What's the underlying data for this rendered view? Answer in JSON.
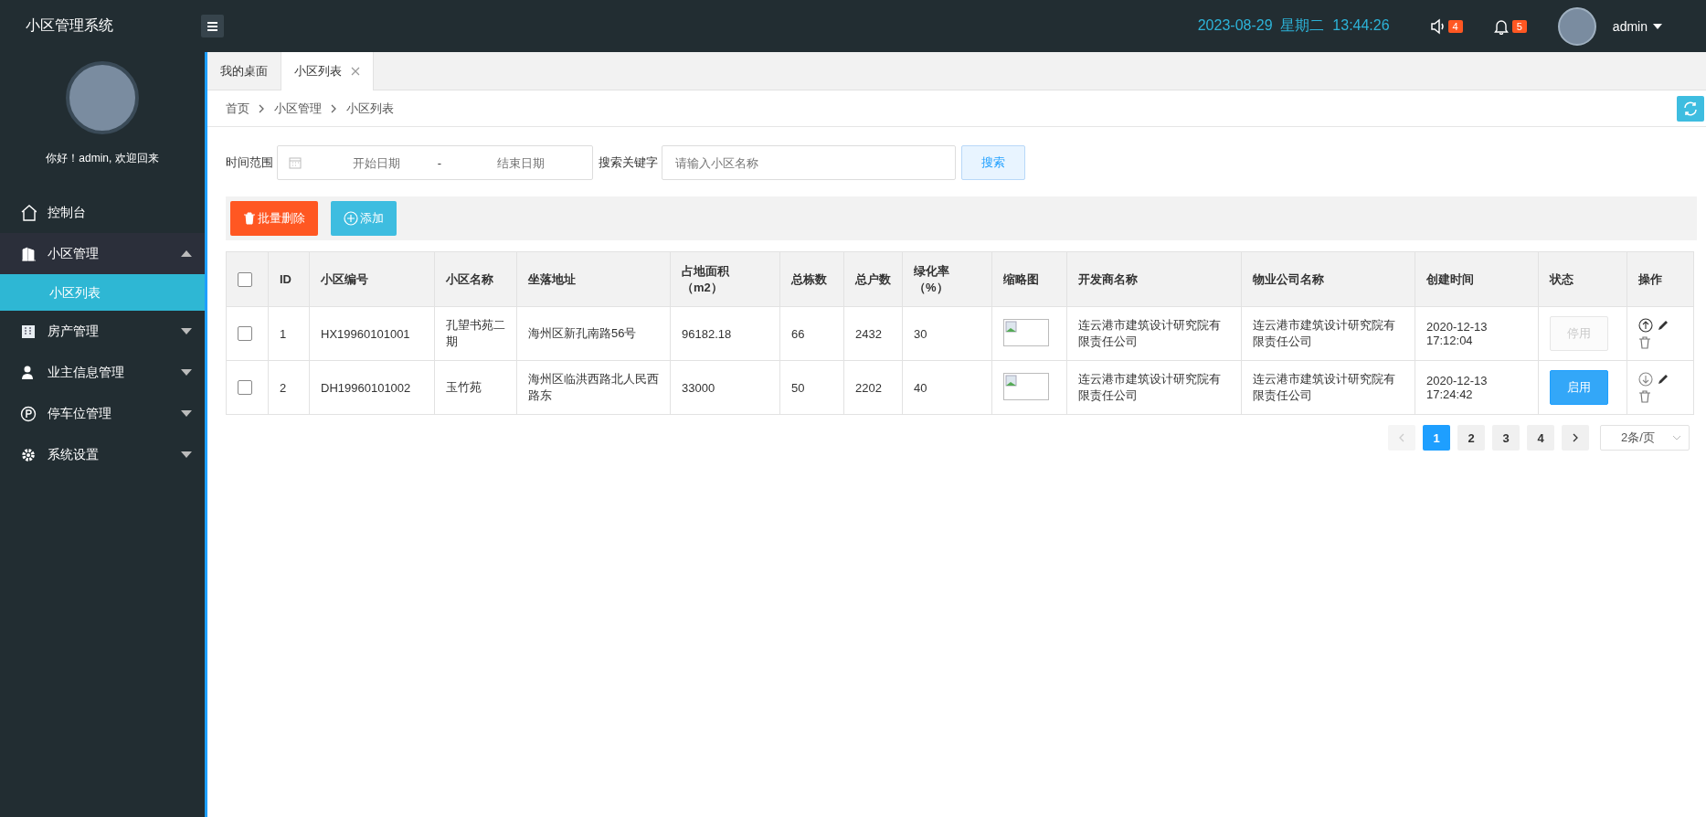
{
  "header": {
    "app_title": "小区管理系统",
    "datetime": "2023-08-29  星期二  13:44:26",
    "notices_count": "4",
    "alerts_count": "5",
    "user": "admin"
  },
  "sidebar": {
    "greeting": "你好！admin, 欢迎回来",
    "items": [
      {
        "label": "控制台",
        "selected": false
      },
      {
        "label": "小区管理",
        "selected": false,
        "expanded": true,
        "children": [
          {
            "label": "小区列表",
            "selected": true
          }
        ]
      },
      {
        "label": "房产管理",
        "selected": false,
        "expanded": false
      },
      {
        "label": "业主信息管理",
        "selected": false,
        "expanded": false
      },
      {
        "label": "停车位管理",
        "selected": false,
        "expanded": false
      },
      {
        "label": "系统设置",
        "selected": false,
        "expanded": false
      }
    ]
  },
  "tabs": [
    {
      "label": "我的桌面",
      "selected": false,
      "closable": false
    },
    {
      "label": "小区列表",
      "selected": true,
      "closable": true
    }
  ],
  "breadcrumb": [
    "首页",
    "小区管理",
    "小区列表"
  ],
  "filters": {
    "time_label": "时间范围",
    "start_placeholder": "开始日期",
    "separator": "-",
    "end_placeholder": "结束日期",
    "keyword_label": "搜索关键字",
    "keyword_placeholder": "请输入小区名称",
    "search_button": "搜索"
  },
  "toolbar": {
    "delete_button": "批量删除",
    "add_button": "添加"
  },
  "table": {
    "header_checked": false,
    "columns": [
      "ID",
      "小区编号",
      "小区名称",
      "坐落地址",
      "占地面积（m2）",
      "总栋数",
      "总户数",
      "绿化率（%）",
      "缩略图",
      "开发商名称",
      "物业公司名称",
      "创建时间",
      "状态",
      "操作"
    ],
    "rows": [
      {
        "checked": false,
        "cells": [
          "1",
          "HX19960101001",
          "孔望书苑二期",
          "海州区新孔南路56号",
          "96182.18",
          "66",
          "2432",
          "30"
        ],
        "developer": "连云港市建筑设计研究院有限责任公司",
        "property_company": "连云港市建筑设计研究院有限责任公司",
        "created": "2020-12-13 17:12:04",
        "status_label": "停用",
        "status_active": false
      },
      {
        "checked": false,
        "cells": [
          "2",
          "DH19960101002",
          "玉竹苑",
          "海州区临洪西路北人民西路东",
          "33000",
          "50",
          "2202",
          "40"
        ],
        "developer": "连云港市建筑设计研究院有限责任公司",
        "property_company": "连云港市建筑设计研究院有限责任公司",
        "created": "2020-12-13 17:24:42",
        "status_label": "启用",
        "status_active": true
      }
    ]
  },
  "pagination": {
    "pages": [
      {
        "label": "1",
        "selected": true
      },
      {
        "label": "2",
        "selected": false
      },
      {
        "label": "3",
        "selected": false
      },
      {
        "label": "4",
        "selected": false
      }
    ],
    "prev_disabled": true,
    "page_size": "2条/页"
  }
}
